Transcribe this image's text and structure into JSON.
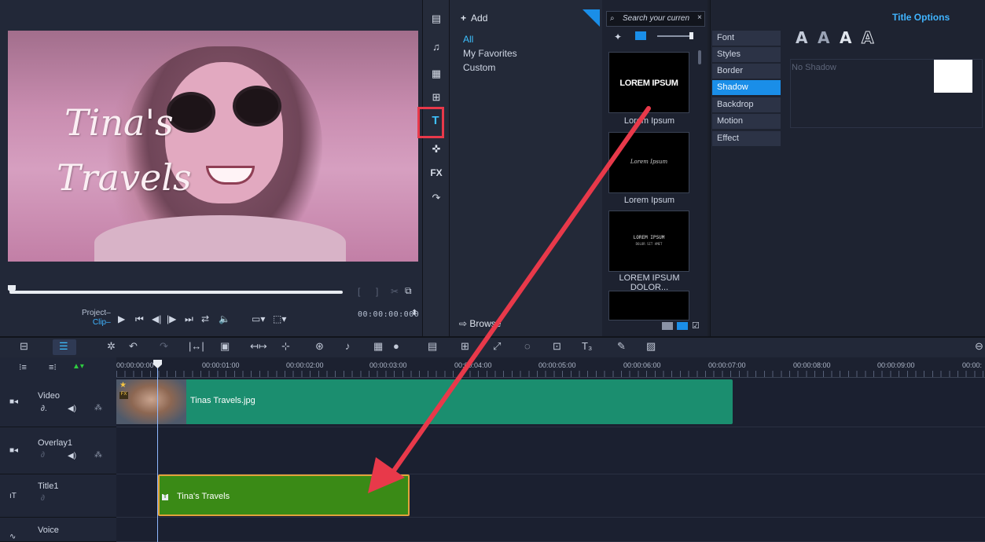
{
  "player": {
    "overlay_title_line1": "Tina's",
    "overlay_title_line2": "Travels",
    "project_label": "Project",
    "clip_label": "Clip",
    "timecode": "00:00:00:000"
  },
  "library": {
    "add_label": "Add",
    "categories": [
      "All",
      "My Favorites",
      "Custom"
    ],
    "selected_category": "All",
    "browse_label": "Browse",
    "side_icons": [
      "media-icon",
      "audio-icon",
      "instant-project-icon",
      "transition-icon",
      "title-icon",
      "graphics-icon",
      "filter-icon",
      "path-icon"
    ],
    "fx_label": "FX"
  },
  "thumbnails": {
    "search_placeholder": "Search your curren",
    "items": [
      {
        "label": "Lorem   Ipsum",
        "preview_text": "LOREM IPSUM"
      },
      {
        "label": "Lorem Ipsum",
        "preview_text": "Lorem Ipsum"
      },
      {
        "label": "LOREM IPSUM DOLOR...",
        "preview_text": "LOREM IPSUM",
        "preview_sub": "DOLOR SIT AMET"
      }
    ]
  },
  "title_options": {
    "heading": "Title Options",
    "tabs": [
      "Font",
      "Styles",
      "Border",
      "Shadow",
      "Backdrop",
      "Motion",
      "Effect"
    ],
    "selected_tab": "Shadow",
    "shadow_label": "No Shadow",
    "style_letters": [
      "A",
      "A",
      "A",
      "A"
    ],
    "swatch_color": "#ffffff"
  },
  "timeline": {
    "ruler_labels": [
      "00:00:00:00",
      "00:00:01:00",
      "00:00:02:00",
      "00:00:03:00",
      "00:00:04:00",
      "00:00:05:00",
      "00:00:06:00",
      "00:00:07:00",
      "00:00:08:00",
      "00:00:09:00",
      "00:00:"
    ],
    "tracks": [
      {
        "name": "Video",
        "icon": "video-track-icon"
      },
      {
        "name": "Overlay1",
        "icon": "overlay-track-icon"
      },
      {
        "name": "Title1",
        "icon": "title-track-icon"
      },
      {
        "name": "Voice",
        "icon": "voice-track-icon"
      }
    ],
    "clips": {
      "video": "Tinas Travels.jpg",
      "title": "Tina's Travels"
    },
    "colors": {
      "video_clip": "#1b8e6f",
      "title_clip": "#3a8a16",
      "title_clip_border": "#e2a23b",
      "accent": "#40b4ff",
      "annotation": "#e8394a"
    }
  }
}
